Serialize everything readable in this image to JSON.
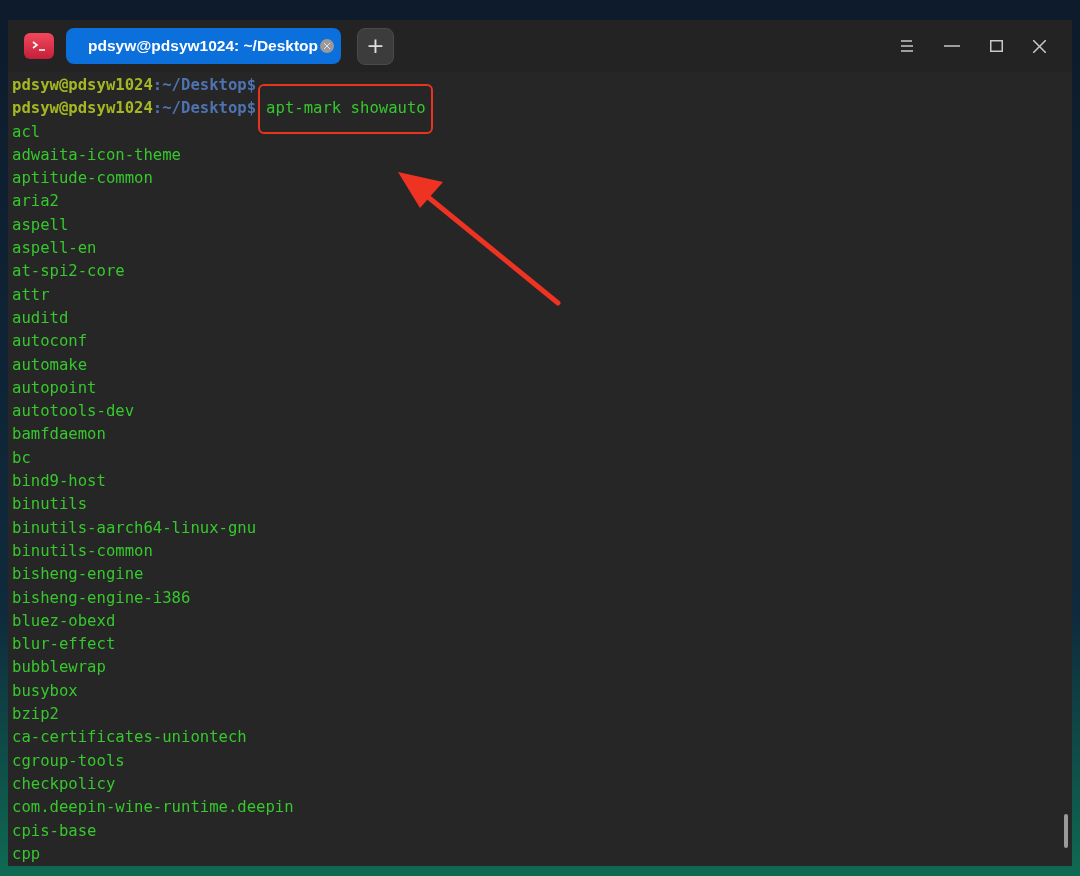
{
  "window": {
    "tabs": [
      {
        "title": "pdsyw@pdsyw1024: ~/Desktop",
        "selected": true
      }
    ],
    "new_tab": "+"
  },
  "prompts": [
    {
      "user": "pdsyw@pdsyw1024",
      "sep": ":",
      "path": "~/Desktop",
      "symbol": "$"
    },
    {
      "user": "pdsyw@pdsyw1024",
      "sep": ":",
      "path": "~/Desktop",
      "symbol": "$",
      "command": "apt-mark showauto"
    }
  ],
  "output": [
    "acl",
    "adwaita-icon-theme",
    "aptitude-common",
    "aria2",
    "aspell",
    "aspell-en",
    "at-spi2-core",
    "attr",
    "auditd",
    "autoconf",
    "automake",
    "autopoint",
    "autotools-dev",
    "bamfdaemon",
    "bc",
    "bind9-host",
    "binutils",
    "binutils-aarch64-linux-gnu",
    "binutils-common",
    "bisheng-engine",
    "bisheng-engine-i386",
    "bluez-obexd",
    "blur-effect",
    "bubblewrap",
    "busybox",
    "bzip2",
    "ca-certificates-uniontech",
    "cgroup-tools",
    "checkpolicy",
    "com.deepin-wine-runtime.deepin",
    "cpis-base",
    "cpp"
  ],
  "annotations": {
    "highlight_box": true,
    "arrow": true
  }
}
